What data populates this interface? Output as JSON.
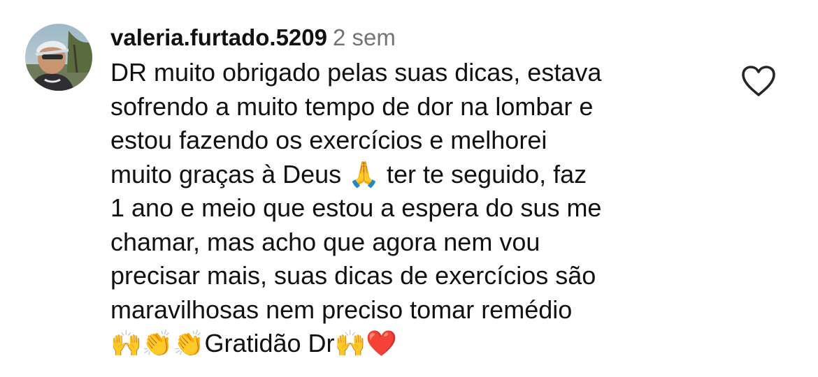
{
  "comment": {
    "username": "valeria.furtado.5209",
    "timestamp": "2 sem",
    "lines": [
      "DR muito obrigado pelas suas dicas, estava",
      "sofrendo a muito tempo de dor na lombar e",
      "estou fazendo os exercícios e melhorei",
      "muito graças à Deus 🙏 ter te seguido, faz",
      "1 ano e meio que estou a espera do sus me",
      "chamar, mas acho que agora nem vou",
      "precisar mais, suas dicas de exercícios são",
      "maravilhosas nem preciso tomar remédio",
      "🙌👏👏Gratidão Dr🙌❤️"
    ],
    "like_icon": "heart-outline-icon",
    "avatar_icon": "profile-photo"
  },
  "colors": {
    "text": "#111111",
    "timestamp": "#737373",
    "heart_outline": "#262626",
    "background": "#ffffff"
  }
}
